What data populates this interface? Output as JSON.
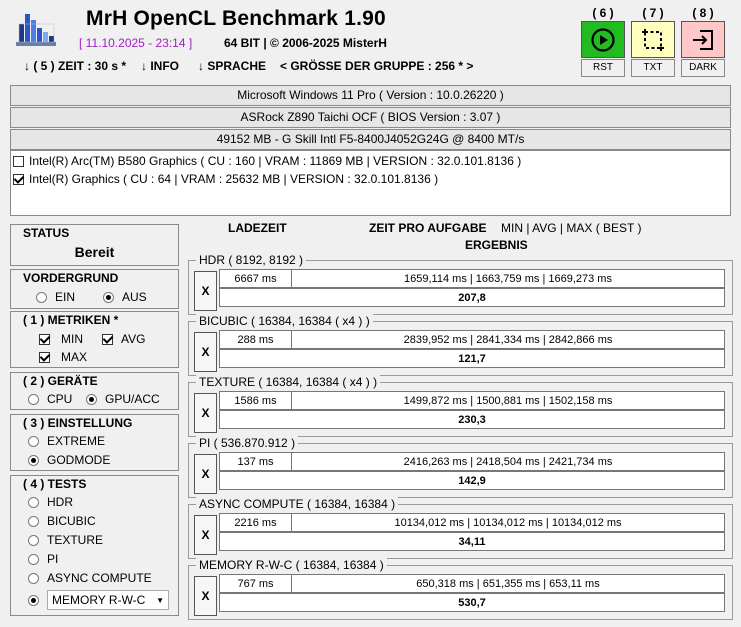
{
  "header": {
    "title": "MrH OpenCL Benchmark 1.90",
    "datetime": "[ 11.10.2025 - 23:14 ]",
    "bits": "64 BIT | ©  2006-2025 MisterH",
    "toolbar": [
      "↓ ( 5 ) ZEIT : 30 s *",
      "↓ INFO",
      "↓ SPRACHE",
      "< GRÖSSE DER GRUPPE : 256 * >"
    ]
  },
  "actions": [
    {
      "hotkey": "( 6 )",
      "label": "RST",
      "icon": "play-icon",
      "color": "#22bb22"
    },
    {
      "hotkey": "( 7 )",
      "label": "TXT",
      "icon": "crop-icon",
      "color": "#ffffc0"
    },
    {
      "hotkey": "( 8 )",
      "label": "DARK",
      "icon": "exit-icon",
      "color": "#ffc8c8"
    }
  ],
  "info": {
    "os": "Microsoft Windows 11 Pro ( Version : 10.0.26220 )",
    "board": "ASRock Z890 Taichi OCF ( BIOS Version : 3.07 )",
    "memory": "49152 MB - G Skill Intl F5-8400J4052G24G     @ 8400 MT/s"
  },
  "devices": [
    {
      "label": "Intel(R) Arc(TM) B580 Graphics ( CU : 160 | VRAM : 11869 MB | VERSION : 32.0.101.8136 )",
      "checked": false
    },
    {
      "label": "Intel(R) Graphics ( CU : 64 | VRAM : 25632 MB | VERSION : 32.0.101.8136 )",
      "checked": true
    }
  ],
  "status": {
    "title": "STATUS",
    "value": "Bereit"
  },
  "vordergrund": {
    "title": "VORDERGRUND",
    "options": [
      "EIN",
      "AUS"
    ],
    "selected": "AUS"
  },
  "metriken": {
    "title": "( 1 ) METRIKEN *",
    "min": "MIN",
    "avg": "AVG",
    "max": "MAX"
  },
  "geraete": {
    "title": "( 2 ) GERÄTE",
    "options": [
      "CPU",
      "GPU/ACC"
    ],
    "selected": "GPU/ACC"
  },
  "einstellung": {
    "title": "( 3 ) EINSTELLUNG",
    "options": [
      "EXTREME",
      "GODMODE"
    ],
    "selected": "GODMODE"
  },
  "tests": {
    "title": "( 4 ) TESTS",
    "options": [
      "HDR",
      "BICUBIC",
      "TEXTURE",
      "PI",
      "ASYNC COMPUTE",
      "MEMORY R-W-C"
    ],
    "selected": "MEMORY R-W-C"
  },
  "results_header": {
    "ladezeit": "LADEZEIT",
    "zeit": "ZEIT PRO AUFGABE",
    "metrics": "MIN | AVG | MAX ( BEST )",
    "ergebnis": "ERGEBNIS"
  },
  "results": [
    {
      "name": "HDR ( 8192, 8192 )",
      "x": "X",
      "load": "6667 ms",
      "times": "1659,114 ms | 1663,759 ms | 1669,273 ms",
      "result": "207,8"
    },
    {
      "name": "BICUBIC ( 16384, 16384 ( x4 ) )",
      "x": "X",
      "load": "288 ms",
      "times": "2839,952 ms | 2841,334 ms | 2842,866 ms",
      "result": "121,7"
    },
    {
      "name": "TEXTURE ( 16384, 16384 ( x4 ) )",
      "x": "X",
      "load": "1586 ms",
      "times": "1499,872 ms | 1500,881 ms | 1502,158 ms",
      "result": "230,3"
    },
    {
      "name": "PI ( 536.870.912 )",
      "x": "X",
      "load": "137 ms",
      "times": "2416,263 ms | 2418,504 ms | 2421,734 ms",
      "result": "142,9"
    },
    {
      "name": "ASYNC COMPUTE ( 16384, 16384 )",
      "x": "X",
      "load": "2216 ms",
      "times": "10134,012 ms | 10134,012 ms | 10134,012 ms",
      "result": "34,11"
    },
    {
      "name": "MEMORY R-W-C ( 16384, 16384 )",
      "x": "X",
      "load": "767 ms",
      "times": "650,318 ms | 651,355 ms | 653,11 ms",
      "result": "530,7"
    }
  ]
}
